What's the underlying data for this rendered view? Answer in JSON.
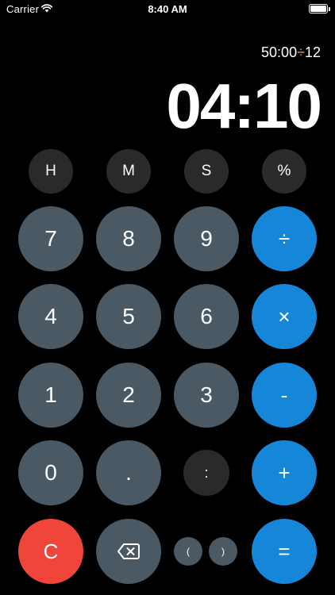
{
  "status_bar": {
    "carrier": "Carrier",
    "time": "8:40 AM"
  },
  "display": {
    "expression_left": "50:00",
    "expression_operator": "÷",
    "expression_right": "12",
    "result": "04:10"
  },
  "unit_keys": [
    "H",
    "M",
    "S",
    "%"
  ],
  "digit_keys": {
    "seven": "7",
    "eight": "8",
    "nine": "9",
    "four": "4",
    "five": "5",
    "six": "6",
    "one": "1",
    "two": "2",
    "three": "3",
    "zero": "0",
    "dot": ".",
    "colon": ":"
  },
  "operator_keys": {
    "divide": "÷",
    "multiply": "×",
    "subtract": "-",
    "add": "+",
    "equals": "="
  },
  "extra_keys": {
    "clear": "C",
    "open_paren": "(",
    "close_paren": ")"
  },
  "icons": {
    "wifi": "wifi-icon",
    "battery": "battery-icon",
    "backspace": "backspace-icon"
  },
  "colors": {
    "background": "#000000",
    "digit": "#4b5964",
    "operator": "#1686d9",
    "clear": "#f0453a",
    "function": "#2a2a2c",
    "accent": "#f39a1d"
  }
}
